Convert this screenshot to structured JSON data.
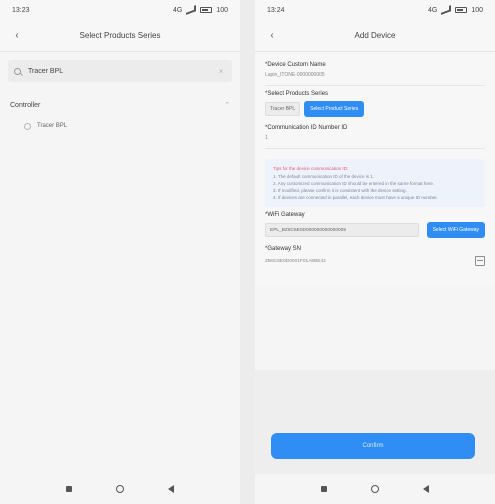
{
  "left_screen": {
    "status": {
      "time": "13:23",
      "signal_text": "4G",
      "battery": "100"
    },
    "header": {
      "title": "Select Products Series"
    },
    "search": {
      "value": "Tracer BPL",
      "placeholder": "Tracer BPL"
    },
    "section": {
      "title": "Controller"
    },
    "items": [
      {
        "label": "Tracer BPL"
      }
    ]
  },
  "right_screen": {
    "status": {
      "time": "13:24",
      "signal_text": "4G",
      "battery": "100"
    },
    "header": {
      "title": "Add Device"
    },
    "form": {
      "custom_name_label": "*Device Custom Name",
      "custom_name_value": "Lapin_ITONE-0000000005",
      "series_label": "*Select Products Series",
      "series_value": "Tracer BPL",
      "series_button": "Select Product Series",
      "comm_label": "*Communication ID Number ID",
      "comm_value": "1",
      "notice_title": "Tips for the device communication ID:",
      "notice_lines": [
        "1. The default communication ID of the device is 1.",
        "2. Any customized communication ID should be entered in the same format here.",
        "3. If modified, please confirm it is consistent with the device setting.",
        "4. If devices are connected in parallel, each device must have a unique ID number."
      ],
      "gateway_label": "*WiFi Gateway",
      "gateway_value": "EPL_BZ6C6E0D000000000000005",
      "gateway_button": "Select WiFi Gateway",
      "sn_label": "*Gateway SN",
      "sn_value": "ZB6C6E0D0001F01A8BE42"
    },
    "confirm_label": "Confirm"
  }
}
